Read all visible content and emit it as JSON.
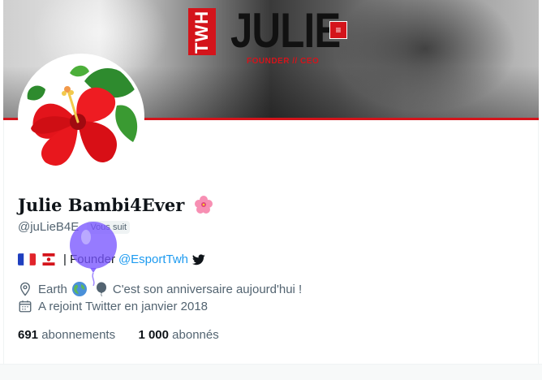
{
  "banner": {
    "brand": "TWH",
    "name": "JULIE",
    "role": "FOUNDER // CEO"
  },
  "profile": {
    "display_name": "Julie Bambi4Ever",
    "handle": "@juLieB4E",
    "follows_you": "Vous suit",
    "bio_text": "| Founder",
    "bio_link": "@EsportTwh",
    "location": "Earth",
    "birthday": "C'est son anniversaire aujourd'hui !",
    "joined": "A rejoint Twitter en janvier 2018"
  },
  "stats": {
    "following_count": "691",
    "following_label": "abonnements",
    "followers_count": "1 000",
    "followers_label": "abonnés"
  },
  "icons": {
    "location": "location-pin-icon",
    "birthday": "balloon-icon",
    "joined": "calendar-icon",
    "bird": "twitter-bird-icon"
  },
  "colors": {
    "link": "#1d9bf0",
    "secondary_text": "#536471",
    "banner_accent": "#d4141b",
    "balloon": "#7856ff"
  }
}
